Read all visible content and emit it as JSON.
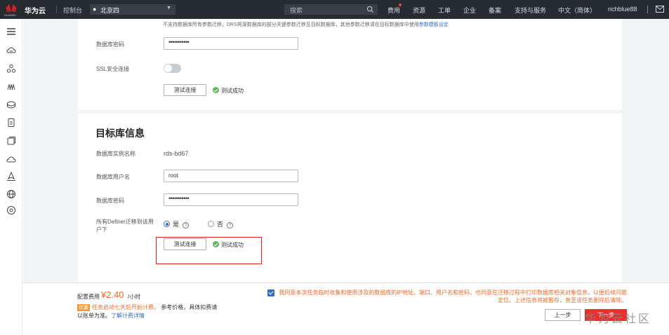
{
  "colors": {
    "topbar_bg": "#272b32",
    "accent_blue": "#3370c4",
    "accent_orange": "#f06a27",
    "danger_red": "#e9302f",
    "success_green": "#5cb85c"
  },
  "topbar": {
    "logo_text": "HUAWEI",
    "brand": "华为云",
    "console": "控制台",
    "region": "北京四",
    "search_placeholder": "搜索",
    "nav": [
      "费用",
      "资源",
      "工单",
      "企业",
      "备案",
      "支持与服务",
      "中文（简体）",
      "richblue88"
    ]
  },
  "sidebar": {
    "icons": [
      "menu-icon",
      "cloud-server-icon",
      "network-icon",
      "cluster-icon",
      "database-icon",
      "storage-icon",
      "monitor-icon",
      "cloud-icon",
      "deploy-icon",
      "globe-icon",
      "settings-icon"
    ]
  },
  "source": {
    "note_prefix": "不支持数据库所有参数迁移，DRS将源数据库的部分关键参数迁移至目标数据库，其他参数迁移请在目标数据库中使用",
    "note_link": "参数模板设定",
    "password_label": "数据库密码",
    "password_value": "•••••••••••",
    "ssl_label": "SSL安全连接",
    "ssl_enabled": false,
    "test_button": "测试连接",
    "test_result": "测试成功"
  },
  "target": {
    "title": "目标库信息",
    "instance_label": "数据库实例名称",
    "instance_value": "rds-bd67",
    "user_label": "数据库用户名",
    "user_value": "root",
    "password_label": "数据库密码",
    "password_value": "•••••••••••",
    "definer_label": "所有Definer迁移到该用户下",
    "definer_yes": "是",
    "definer_no": "否",
    "definer_selected": "是",
    "help_glyph": "?",
    "test_button": "测试连接",
    "test_result": "测试成功"
  },
  "footer": {
    "fee_label": "配置费用",
    "fee_price": "¥2.40",
    "fee_unit": "/小时",
    "promo_tag": "优惠",
    "promo_text": "任务启动七天后开始计费。",
    "promo_note": "参考价格，具体扣费请",
    "promo_line2": "以账单为准。",
    "promo_link": "了解计费详情",
    "agree_text": "我同意本次任务临时收集和使用涉及的数据库的IP地址、端口、用户名和密码，也同意在迁移过程中打印数据库相关对象信息，以便后续问题定位。上述信息将被暂存，直至该任务删除后清除。",
    "agree_checked": true,
    "prev_button": "上一步",
    "next_button": "下一步"
  },
  "watermark": "华为云社区"
}
